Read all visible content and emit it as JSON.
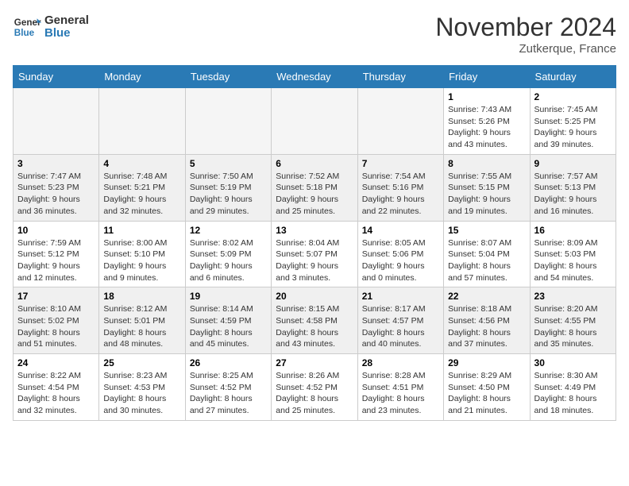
{
  "logo": {
    "line1": "General",
    "line2": "Blue"
  },
  "title": "November 2024",
  "location": "Zutkerque, France",
  "days_of_week": [
    "Sunday",
    "Monday",
    "Tuesday",
    "Wednesday",
    "Thursday",
    "Friday",
    "Saturday"
  ],
  "weeks": [
    [
      {
        "day": "",
        "info": ""
      },
      {
        "day": "",
        "info": ""
      },
      {
        "day": "",
        "info": ""
      },
      {
        "day": "",
        "info": ""
      },
      {
        "day": "",
        "info": ""
      },
      {
        "day": "1",
        "info": "Sunrise: 7:43 AM\nSunset: 5:26 PM\nDaylight: 9 hours and 43 minutes."
      },
      {
        "day": "2",
        "info": "Sunrise: 7:45 AM\nSunset: 5:25 PM\nDaylight: 9 hours and 39 minutes."
      }
    ],
    [
      {
        "day": "3",
        "info": "Sunrise: 7:47 AM\nSunset: 5:23 PM\nDaylight: 9 hours and 36 minutes."
      },
      {
        "day": "4",
        "info": "Sunrise: 7:48 AM\nSunset: 5:21 PM\nDaylight: 9 hours and 32 minutes."
      },
      {
        "day": "5",
        "info": "Sunrise: 7:50 AM\nSunset: 5:19 PM\nDaylight: 9 hours and 29 minutes."
      },
      {
        "day": "6",
        "info": "Sunrise: 7:52 AM\nSunset: 5:18 PM\nDaylight: 9 hours and 25 minutes."
      },
      {
        "day": "7",
        "info": "Sunrise: 7:54 AM\nSunset: 5:16 PM\nDaylight: 9 hours and 22 minutes."
      },
      {
        "day": "8",
        "info": "Sunrise: 7:55 AM\nSunset: 5:15 PM\nDaylight: 9 hours and 19 minutes."
      },
      {
        "day": "9",
        "info": "Sunrise: 7:57 AM\nSunset: 5:13 PM\nDaylight: 9 hours and 16 minutes."
      }
    ],
    [
      {
        "day": "10",
        "info": "Sunrise: 7:59 AM\nSunset: 5:12 PM\nDaylight: 9 hours and 12 minutes."
      },
      {
        "day": "11",
        "info": "Sunrise: 8:00 AM\nSunset: 5:10 PM\nDaylight: 9 hours and 9 minutes."
      },
      {
        "day": "12",
        "info": "Sunrise: 8:02 AM\nSunset: 5:09 PM\nDaylight: 9 hours and 6 minutes."
      },
      {
        "day": "13",
        "info": "Sunrise: 8:04 AM\nSunset: 5:07 PM\nDaylight: 9 hours and 3 minutes."
      },
      {
        "day": "14",
        "info": "Sunrise: 8:05 AM\nSunset: 5:06 PM\nDaylight: 9 hours and 0 minutes."
      },
      {
        "day": "15",
        "info": "Sunrise: 8:07 AM\nSunset: 5:04 PM\nDaylight: 8 hours and 57 minutes."
      },
      {
        "day": "16",
        "info": "Sunrise: 8:09 AM\nSunset: 5:03 PM\nDaylight: 8 hours and 54 minutes."
      }
    ],
    [
      {
        "day": "17",
        "info": "Sunrise: 8:10 AM\nSunset: 5:02 PM\nDaylight: 8 hours and 51 minutes."
      },
      {
        "day": "18",
        "info": "Sunrise: 8:12 AM\nSunset: 5:01 PM\nDaylight: 8 hours and 48 minutes."
      },
      {
        "day": "19",
        "info": "Sunrise: 8:14 AM\nSunset: 4:59 PM\nDaylight: 8 hours and 45 minutes."
      },
      {
        "day": "20",
        "info": "Sunrise: 8:15 AM\nSunset: 4:58 PM\nDaylight: 8 hours and 43 minutes."
      },
      {
        "day": "21",
        "info": "Sunrise: 8:17 AM\nSunset: 4:57 PM\nDaylight: 8 hours and 40 minutes."
      },
      {
        "day": "22",
        "info": "Sunrise: 8:18 AM\nSunset: 4:56 PM\nDaylight: 8 hours and 37 minutes."
      },
      {
        "day": "23",
        "info": "Sunrise: 8:20 AM\nSunset: 4:55 PM\nDaylight: 8 hours and 35 minutes."
      }
    ],
    [
      {
        "day": "24",
        "info": "Sunrise: 8:22 AM\nSunset: 4:54 PM\nDaylight: 8 hours and 32 minutes."
      },
      {
        "day": "25",
        "info": "Sunrise: 8:23 AM\nSunset: 4:53 PM\nDaylight: 8 hours and 30 minutes."
      },
      {
        "day": "26",
        "info": "Sunrise: 8:25 AM\nSunset: 4:52 PM\nDaylight: 8 hours and 27 minutes."
      },
      {
        "day": "27",
        "info": "Sunrise: 8:26 AM\nSunset: 4:52 PM\nDaylight: 8 hours and 25 minutes."
      },
      {
        "day": "28",
        "info": "Sunrise: 8:28 AM\nSunset: 4:51 PM\nDaylight: 8 hours and 23 minutes."
      },
      {
        "day": "29",
        "info": "Sunrise: 8:29 AM\nSunset: 4:50 PM\nDaylight: 8 hours and 21 minutes."
      },
      {
        "day": "30",
        "info": "Sunrise: 8:30 AM\nSunset: 4:49 PM\nDaylight: 8 hours and 18 minutes."
      }
    ]
  ]
}
